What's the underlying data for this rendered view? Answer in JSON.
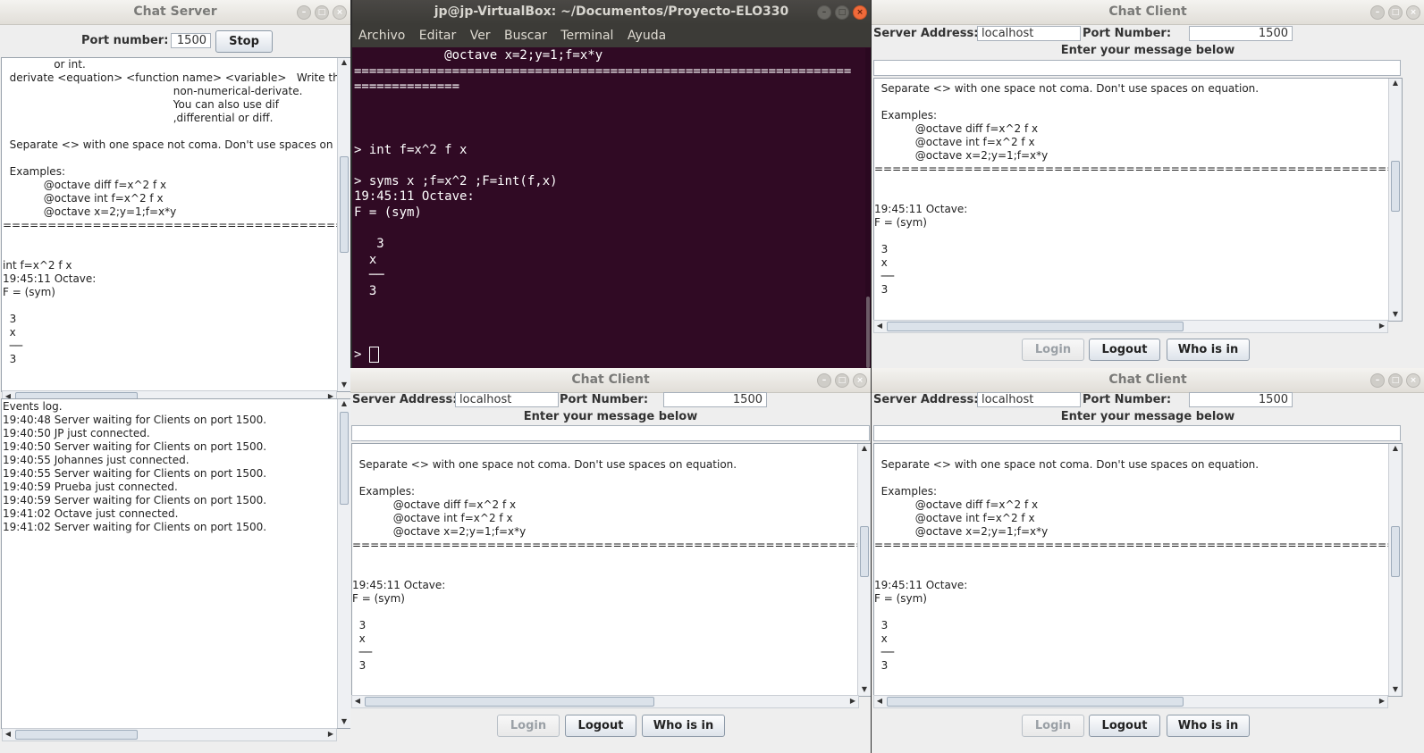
{
  "server": {
    "title": "Chat Server",
    "port_label": "Port number:",
    "port_value": "1500",
    "stop_button": "Stop",
    "chat_text": "               or int.\n  derivate <equation> <function name> <variable>   Write the\n                                                  non-numerical-derivate.\n                                                  You can also use dif\n                                                  ,differential or diff.\n\n  Separate <> with one space not coma. Don't use spaces on e\n\n  Examples:\n            @octave diff f=x^2 f x\n            @octave int f=x^2 f x\n            @octave x=2;y=1;f=x*y\n==============================================================\n\n\nint f=x^2 f x\n19:45:11 Octave:\nF = (sym)\n\n  3\n  x\n  ──\n  3",
    "events_text": "Events log.\n19:40:48 Server waiting for Clients on port 1500.\n19:40:50 JP just connected.\n19:40:50 Server waiting for Clients on port 1500.\n19:40:55 Johannes just connected.\n19:40:55 Server waiting for Clients on port 1500.\n19:40:59 Prueba just connected.\n19:40:59 Server waiting for Clients on port 1500.\n19:41:02 Octave just connected.\n19:41:02 Server waiting for Clients on port 1500."
  },
  "terminal": {
    "title": "jp@jp-VirtualBox: ~/Documentos/Proyecto-ELO330",
    "menu": [
      "Archivo",
      "Editar",
      "Ver",
      "Buscar",
      "Terminal",
      "Ayuda"
    ],
    "text": "            @octave x=2;y=1;f=x*y\n==================================================================\n==============\n\n\n\n> int f=x^2 f x\n\n> syms x ;f=x^2 ;F=int(f,x)\n19:45:11 Octave:\nF = (sym)\n\n   3\n  x\n  ──\n  3\n\n\n\n> "
  },
  "client_common": {
    "title": "Chat Client",
    "server_label": "Server Address:",
    "server_value": "localhost",
    "port_label": "Port Number:",
    "port_value": "1500",
    "enter_label": "Enter your message below",
    "login": "Login",
    "logout": "Logout",
    "whoisin": "Who is in",
    "chat_text": "  Separate <> with one space not coma. Don't use spaces on equation.\n\n  Examples:\n            @octave diff f=x^2 f x\n            @octave int f=x^2 f x\n            @octave x=2;y=1;f=x*y\n======================================================================================================\n\n\n19:45:11 Octave:\nF = (sym)\n\n  3\n  x\n  ──\n  3"
  },
  "colors": {
    "terminal_bg": "#300a24",
    "close_button": "#f06a3a"
  }
}
